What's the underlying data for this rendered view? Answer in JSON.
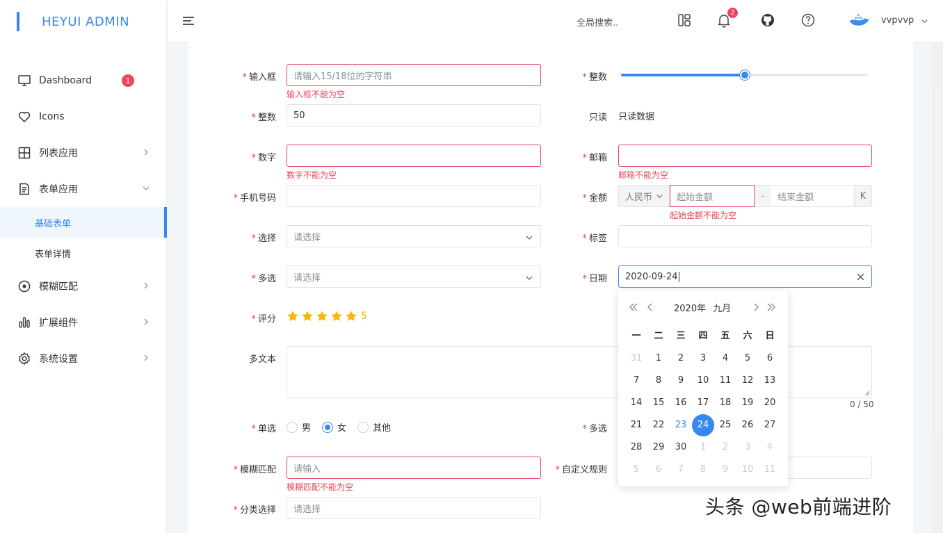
{
  "app": {
    "title": "HEYUI ADMIN"
  },
  "sidebar": {
    "items": [
      {
        "label": "Dashboard",
        "icon": "monitor-icon",
        "badge": "1"
      },
      {
        "label": "Icons",
        "icon": "heart-icon"
      },
      {
        "label": "列表应用",
        "icon": "grid-icon"
      },
      {
        "label": "表单应用",
        "icon": "form-icon"
      },
      {
        "label": "模糊匹配",
        "icon": "target-icon"
      },
      {
        "label": "扩展组件",
        "icon": "bar-chart-icon"
      },
      {
        "label": "系统设置",
        "icon": "gear-icon"
      }
    ],
    "sub_items": [
      {
        "label": "基础表单",
        "active": true
      },
      {
        "label": "表单详情",
        "active": false
      }
    ]
  },
  "header": {
    "search_placeholder": "全局搜索..",
    "notification_count": "2",
    "username": "vvpvvp"
  },
  "form": {
    "input_box": {
      "label": "输入框",
      "placeholder": "请输入15/18位的字符串",
      "error": "输入框不能为空"
    },
    "integer_slider": {
      "label": "整数",
      "value_fraction": 0.5
    },
    "integer": {
      "label": "整数",
      "value": "50"
    },
    "readonly": {
      "label": "只读",
      "value": "只读数据"
    },
    "number": {
      "label": "数字",
      "error": "数字不能为空"
    },
    "email": {
      "label": "邮箱",
      "error": "邮箱不能为空"
    },
    "phone": {
      "label": "手机号码"
    },
    "amount": {
      "label": "金额",
      "currency": "人民币",
      "start_placeholder": "起始金额",
      "dash": "-",
      "end_placeholder": "结束金额",
      "unit": "K",
      "error": "起始金额不能为空"
    },
    "select": {
      "label": "选择",
      "placeholder": "请选择"
    },
    "tags": {
      "label": "标签"
    },
    "multi_select": {
      "label": "多选",
      "placeholder": "请选择"
    },
    "date": {
      "label": "日期",
      "value": "2020-09-24"
    },
    "rating": {
      "label": "评分",
      "value": "5",
      "stars": 5
    },
    "textarea": {
      "label": "多文本",
      "counter": "0 / 50"
    },
    "radio": {
      "label": "单选",
      "options": [
        "男",
        "女",
        "其他"
      ],
      "selected": "女"
    },
    "checkbox": {
      "label": "多选"
    },
    "fuzzy": {
      "label": "模糊匹配",
      "placeholder": "请输入",
      "error": "模糊匹配不能为空"
    },
    "custom_rule": {
      "label": "自定义规则"
    },
    "category": {
      "label": "分类选择",
      "placeholder": "请选择"
    }
  },
  "calendar": {
    "year": "2020年",
    "month": "九月",
    "weekdays": [
      "一",
      "二",
      "三",
      "四",
      "五",
      "六",
      "日"
    ],
    "weeks": [
      [
        "31",
        "1",
        "2",
        "3",
        "4",
        "5",
        "6"
      ],
      [
        "7",
        "8",
        "9",
        "10",
        "11",
        "12",
        "13"
      ],
      [
        "14",
        "15",
        "16",
        "17",
        "18",
        "19",
        "20"
      ],
      [
        "21",
        "22",
        "23",
        "24",
        "25",
        "26",
        "27"
      ],
      [
        "28",
        "29",
        "30",
        "1",
        "2",
        "3",
        "4"
      ],
      [
        "5",
        "6",
        "7",
        "8",
        "9",
        "10",
        "11"
      ]
    ],
    "today": "23",
    "selected": "24"
  },
  "watermark": "头条 @web前端进阶",
  "colors": {
    "primary": "#3788ee",
    "error": "#e8455a",
    "star": "#f5b70a"
  }
}
